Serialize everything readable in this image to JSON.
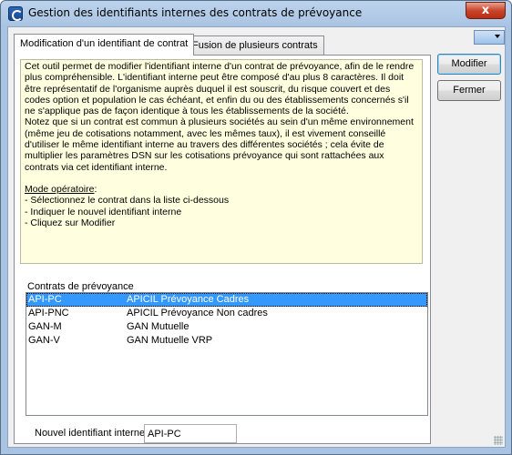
{
  "window": {
    "title": "Gestion des identifiants internes des contrats de prévoyance",
    "close_label": "x"
  },
  "tabs": [
    {
      "label": "Modification d'un identifiant de contrat"
    },
    {
      "label": "Fusion de plusieurs contrats"
    }
  ],
  "description": {
    "p1": "Cet outil permet de modifier l'identifiant interne d'un contrat de prévoyance, afin de le rendre plus compréhensible. L'identifiant interne peut être composé d'au plus 8 caractères. Il doit être représentatif de l'organisme auprès duquel il est souscrit, du risque couvert et des codes option et population le cas échéant, et enfin du ou des établissements concernés s'il ne s'applique pas de façon identique à tous les établissements de la société.",
    "p2": "Notez que si un contrat est commun à plusieurs sociétés au sein d'un même environnement (même jeu de cotisations notamment, avec les mêmes taux), il est vivement conseillé d'utiliser le même identifiant interne au travers des différentes sociétés ; cela évite de multiplier les paramètres DSN sur les cotisations prévoyance qui sont rattachées aux contrats via cet identifiant interne.",
    "mode_title": "Mode opératoire",
    "mode_colon": " :",
    "steps": [
      "- Sélectionnez le contrat dans la liste ci-dessous",
      "- Indiquer le nouvel identifiant interne",
      "- Cliquez sur Modifier"
    ]
  },
  "contracts": {
    "label": "Contrats de prévoyance",
    "rows": [
      {
        "code": "API-PC",
        "name": "APICIL Prévoyance Cadres",
        "selected": true
      },
      {
        "code": "API-PNC",
        "name": "APICIL Prévoyance Non cadres",
        "selected": false
      },
      {
        "code": "GAN-M",
        "name": "GAN Mutuelle",
        "selected": false
      },
      {
        "code": "GAN-V",
        "name": "GAN Mutuelle VRP",
        "selected": false
      }
    ]
  },
  "new_id": {
    "label": "Nouvel identifiant interne",
    "value": "API-PC"
  },
  "buttons": {
    "modify": "Modifier",
    "close": "Fermer"
  },
  "colors": {
    "selection": "#3399ff",
    "note_background": "#ffffe0",
    "titlebar": "#a9c4e3"
  }
}
